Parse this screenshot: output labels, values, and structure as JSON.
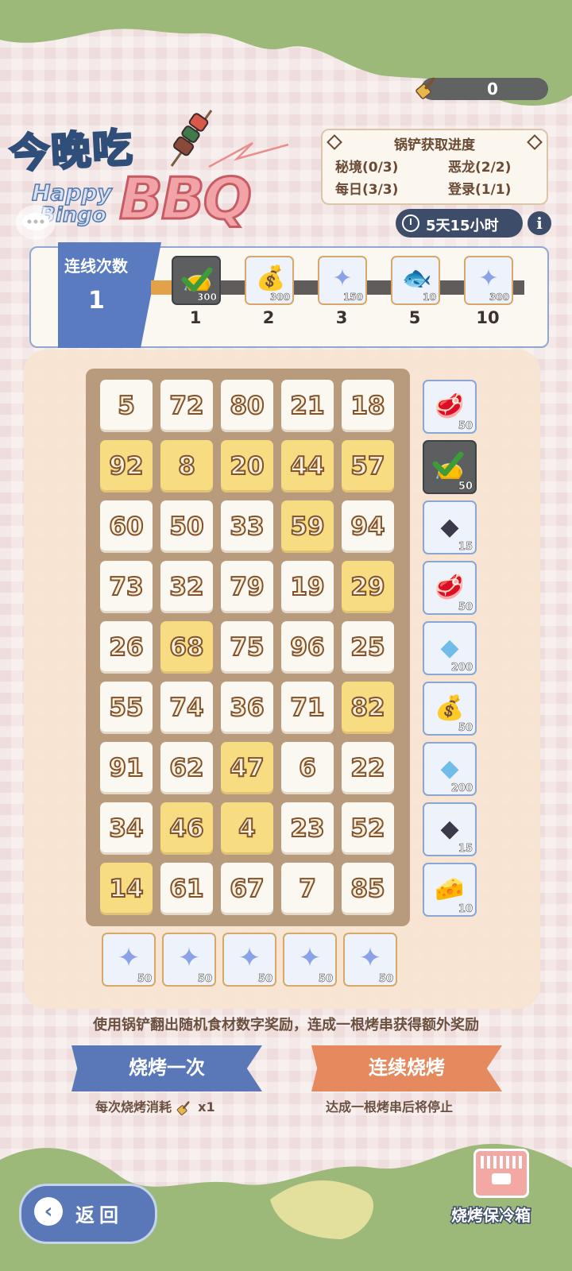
{
  "currency": {
    "value": "0",
    "icon": "spatula-icon"
  },
  "title": {
    "main": "今晚吃",
    "happy": "Happy",
    "bingo": "Bingo",
    "bbq": "BBQ"
  },
  "progress_panel": {
    "title": "锅铲获取进度",
    "items": [
      {
        "label": "秘境(0/3)"
      },
      {
        "label": "恶龙(2/2)"
      },
      {
        "label": "每日(3/3)"
      },
      {
        "label": "登录(1/1)"
      }
    ]
  },
  "timer": {
    "text": "5天15小时",
    "info": "i"
  },
  "line_count": {
    "label": "连线次数",
    "value": "1",
    "milestones": [
      {
        "lines": "1",
        "count": "300",
        "item": "bag",
        "claimed": true
      },
      {
        "lines": "2",
        "count": "300",
        "item": "paw-bag"
      },
      {
        "lines": "3",
        "count": "150",
        "item": "star-crystal"
      },
      {
        "lines": "5",
        "count": "10",
        "item": "fish-card"
      },
      {
        "lines": "10",
        "count": "300",
        "item": "star-crystal"
      }
    ]
  },
  "board": {
    "rows": [
      [
        {
          "n": "5",
          "lit": false
        },
        {
          "n": "72",
          "lit": false
        },
        {
          "n": "80",
          "lit": false
        },
        {
          "n": "21",
          "lit": false
        },
        {
          "n": "18",
          "lit": false
        }
      ],
      [
        {
          "n": "92",
          "lit": true
        },
        {
          "n": "8",
          "lit": true
        },
        {
          "n": "20",
          "lit": true
        },
        {
          "n": "44",
          "lit": true
        },
        {
          "n": "57",
          "lit": true
        }
      ],
      [
        {
          "n": "60",
          "lit": false
        },
        {
          "n": "50",
          "lit": false
        },
        {
          "n": "33",
          "lit": false
        },
        {
          "n": "59",
          "lit": true
        },
        {
          "n": "94",
          "lit": false
        }
      ],
      [
        {
          "n": "73",
          "lit": false
        },
        {
          "n": "32",
          "lit": false
        },
        {
          "n": "79",
          "lit": false
        },
        {
          "n": "19",
          "lit": false
        },
        {
          "n": "29",
          "lit": true
        }
      ],
      [
        {
          "n": "26",
          "lit": false
        },
        {
          "n": "68",
          "lit": true
        },
        {
          "n": "75",
          "lit": false
        },
        {
          "n": "96",
          "lit": false
        },
        {
          "n": "25",
          "lit": false
        }
      ],
      [
        {
          "n": "55",
          "lit": false
        },
        {
          "n": "74",
          "lit": false
        },
        {
          "n": "36",
          "lit": false
        },
        {
          "n": "71",
          "lit": false
        },
        {
          "n": "82",
          "lit": true
        }
      ],
      [
        {
          "n": "91",
          "lit": false
        },
        {
          "n": "62",
          "lit": false
        },
        {
          "n": "47",
          "lit": true
        },
        {
          "n": "6",
          "lit": false
        },
        {
          "n": "22",
          "lit": false
        }
      ],
      [
        {
          "n": "34",
          "lit": false
        },
        {
          "n": "46",
          "lit": true
        },
        {
          "n": "4",
          "lit": true
        },
        {
          "n": "23",
          "lit": false
        },
        {
          "n": "52",
          "lit": false
        }
      ],
      [
        {
          "n": "14",
          "lit": true
        },
        {
          "n": "61",
          "lit": false
        },
        {
          "n": "67",
          "lit": false
        },
        {
          "n": "7",
          "lit": false
        },
        {
          "n": "85",
          "lit": false
        }
      ]
    ],
    "row_rewards": [
      {
        "count": "50",
        "item": "meat"
      },
      {
        "count": "50",
        "item": "bag",
        "claimed": true
      },
      {
        "count": "15",
        "item": "ore"
      },
      {
        "count": "50",
        "item": "meat"
      },
      {
        "count": "200",
        "item": "crystal"
      },
      {
        "count": "50",
        "item": "paw-bag"
      },
      {
        "count": "200",
        "item": "crystal"
      },
      {
        "count": "15",
        "item": "ore"
      },
      {
        "count": "10",
        "item": "cheese"
      }
    ],
    "column_rewards": [
      {
        "count": "50",
        "item": "star-crystal"
      },
      {
        "count": "50",
        "item": "star-crystal"
      },
      {
        "count": "50",
        "item": "star-crystal"
      },
      {
        "count": "50",
        "item": "star-crystal"
      },
      {
        "count": "50",
        "item": "star-crystal"
      }
    ]
  },
  "description": "使用锅铲翻出随机食材数字奖励，连成一根烤串获得额外奖励",
  "buttons": {
    "once": {
      "label": "烧烤一次",
      "sub": "每次烧烤消耗",
      "cost": "x1"
    },
    "continuous": {
      "label": "连续烧烤",
      "sub": "达成一根烤串后将停止"
    }
  },
  "back": {
    "label": "返回"
  },
  "cooler": {
    "label": "烧烤保冷箱"
  }
}
